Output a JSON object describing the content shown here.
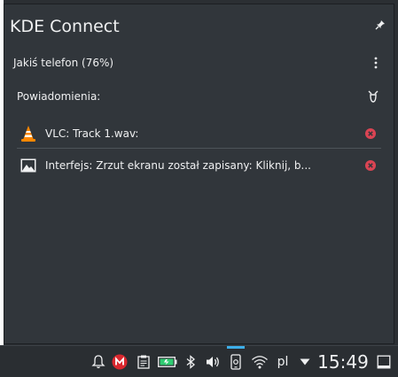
{
  "popup": {
    "title": "KDE Connect",
    "device_name": "Jakiś telefon (76%)",
    "notifications_label": "Powiadomienia:",
    "notifications": [
      {
        "app_icon": "vlc-cone-icon",
        "text": "VLC: Track 1.wav:"
      },
      {
        "app_icon": "image-icon",
        "text": "Interfejs: Zrzut ekranu został zapisany: Kliknij, b..."
      }
    ]
  },
  "taskbar": {
    "language": "pl",
    "clock": "15:49",
    "icons": [
      "bell-icon",
      "mega-icon",
      "clipboard-icon",
      "battery-icon",
      "bluetooth-icon",
      "volume-icon",
      "kdeconnect-icon",
      "wifi-icon",
      "language-indicator",
      "expand-arrow-icon",
      "clock",
      "show-desktop-icon"
    ]
  },
  "colors": {
    "popup_bg": "#31363b",
    "accent": "#3daee9",
    "close_red": "#da4453",
    "mega_red": "#d9272e"
  }
}
